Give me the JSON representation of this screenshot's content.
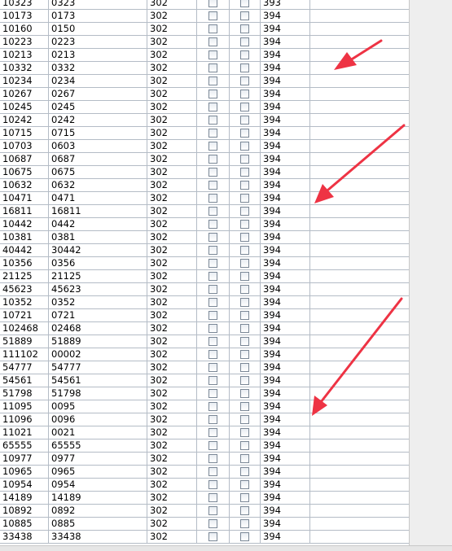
{
  "table": {
    "rows": [
      [
        "10323",
        "0323",
        "302",
        "393"
      ],
      [
        "10173",
        "0173",
        "302",
        "394"
      ],
      [
        "10160",
        "0150",
        "302",
        "394"
      ],
      [
        "10223",
        "0223",
        "302",
        "394"
      ],
      [
        "10213",
        "0213",
        "302",
        "394"
      ],
      [
        "10332",
        "0332",
        "302",
        "394"
      ],
      [
        "10234",
        "0234",
        "302",
        "394"
      ],
      [
        "10267",
        "0267",
        "302",
        "394"
      ],
      [
        "10245",
        "0245",
        "302",
        "394"
      ],
      [
        "10242",
        "0242",
        "302",
        "394"
      ],
      [
        "10715",
        "0715",
        "302",
        "394"
      ],
      [
        "10703",
        "0603",
        "302",
        "394"
      ],
      [
        "10687",
        "0687",
        "302",
        "394"
      ],
      [
        "10675",
        "0675",
        "302",
        "394"
      ],
      [
        "10632",
        "0632",
        "302",
        "394"
      ],
      [
        "10471",
        "0471",
        "302",
        "394"
      ],
      [
        "16811",
        "16811",
        "302",
        "394"
      ],
      [
        "10442",
        "0442",
        "302",
        "394"
      ],
      [
        "10381",
        "0381",
        "302",
        "394"
      ],
      [
        "40442",
        "30442",
        "302",
        "394"
      ],
      [
        "10356",
        "0356",
        "302",
        "394"
      ],
      [
        "21125",
        "21125",
        "302",
        "394"
      ],
      [
        "45623",
        "45623",
        "302",
        "394"
      ],
      [
        "10352",
        "0352",
        "302",
        "394"
      ],
      [
        "10721",
        "0721",
        "302",
        "394"
      ],
      [
        "102468",
        "02468",
        "302",
        "394"
      ],
      [
        "51889",
        "51889",
        "302",
        "394"
      ],
      [
        "111102",
        "00002",
        "302",
        "394"
      ],
      [
        "54777",
        "54777",
        "302",
        "394"
      ],
      [
        "54561",
        "54561",
        "302",
        "394"
      ],
      [
        "51798",
        "51798",
        "302",
        "394"
      ],
      [
        "11095",
        "0095",
        "302",
        "394"
      ],
      [
        "11096",
        "0096",
        "302",
        "394"
      ],
      [
        "11021",
        "0021",
        "302",
        "394"
      ],
      [
        "65555",
        "65555",
        "302",
        "394"
      ],
      [
        "10977",
        "0977",
        "302",
        "394"
      ],
      [
        "10965",
        "0965",
        "302",
        "394"
      ],
      [
        "10954",
        "0954",
        "302",
        "394"
      ],
      [
        "14189",
        "14189",
        "302",
        "394"
      ],
      [
        "10892",
        "0892",
        "302",
        "394"
      ],
      [
        "10885",
        "0885",
        "302",
        "394"
      ],
      [
        "33438",
        "33438",
        "302",
        "394"
      ]
    ]
  },
  "colors": {
    "grid": "#b4bcc6",
    "arrow": "#ee3344",
    "scrollbar": "#eeeeee"
  },
  "icons": {
    "checkbox": "checkbox-icon",
    "annotation": "red-arrow-annotation"
  }
}
